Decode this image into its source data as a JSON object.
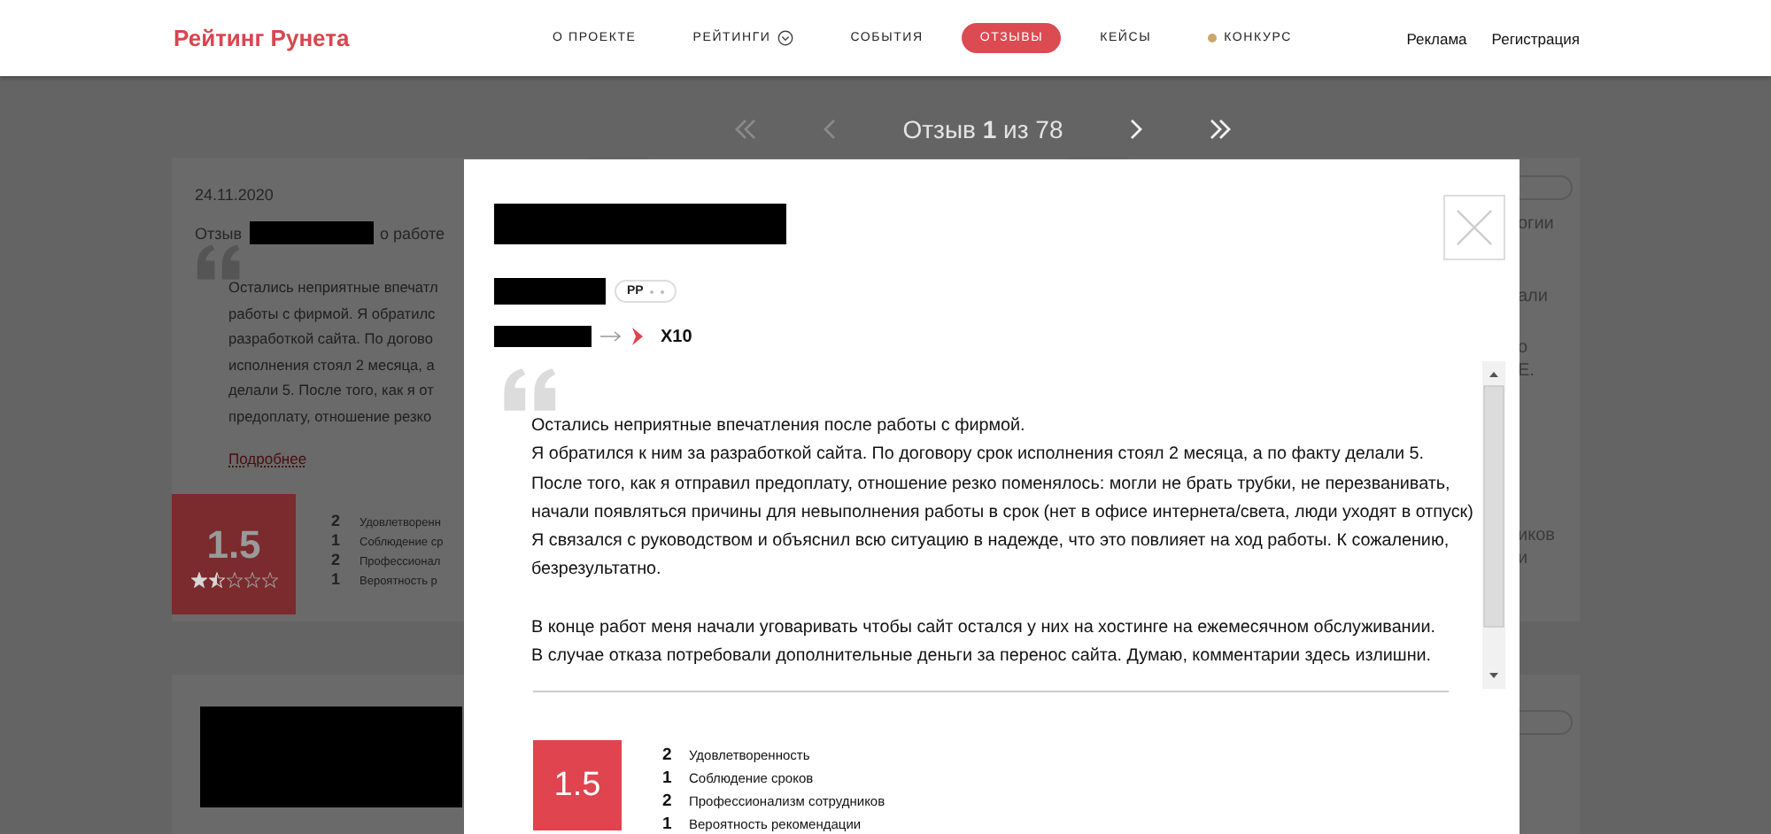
{
  "header": {
    "logo": "Рейтинг Рунета",
    "nav": [
      {
        "label": "О ПРОЕКТЕ",
        "selected": false,
        "kind": "plain"
      },
      {
        "label": "РЕЙТИНГИ",
        "selected": false,
        "kind": "dropdown"
      },
      {
        "label": "СОБЫТИЯ",
        "selected": false,
        "kind": "plain"
      },
      {
        "label": "ОТЗЫВЫ",
        "selected": true,
        "kind": "plain"
      },
      {
        "label": "КЕЙСЫ",
        "selected": false,
        "kind": "plain"
      },
      {
        "label": "КОНКУРС",
        "selected": false,
        "kind": "dot"
      }
    ],
    "links": [
      "Реклама",
      "Регистрация"
    ]
  },
  "pager": {
    "buttons": [
      {
        "kind": "first",
        "disabled": true
      },
      {
        "kind": "prev",
        "disabled": true
      },
      {
        "kind": "next",
        "disabled": false
      },
      {
        "kind": "last",
        "disabled": false
      }
    ],
    "label": "Отзыв **1** из 78"
  },
  "left_card": {
    "date": "24.11.2020",
    "title_before": "Отзыв",
    "title_after": "о работе",
    "lines": [
      "Остались неприятные впечатл",
      "работы с фирмой. Я обратилс",
      "разработкой сайта. По догово",
      "исполнения стоял 2 месяца, а",
      "делали 5. После того, как я от",
      "предоплату, отношение резко"
    ],
    "more": "Подробнее",
    "score": "1.5",
    "stars": 1.5,
    "criteria": [
      {
        "value": "2",
        "label": "Удовлетворенн"
      },
      {
        "value": "1",
        "label": "Соблюдение ср"
      },
      {
        "value": "2",
        "label": "Профессионал"
      },
      {
        "value": "1",
        "label": "Вероятность р"
      }
    ]
  },
  "right_card": {
    "fragments": [
      "огии",
      "али",
      "о",
      "Е.",
      "иков",
      "и"
    ]
  },
  "modal": {
    "tag": "PP",
    "target": "X10",
    "paragraphs": [
      "Остались неприятные впечатления после работы с фирмой.\nЯ обратился к ним за разработкой сайта. По договору срок исполнения стоял 2 месяца, а по факту делали 5.\nПосле того, как я отправил предоплату, отношение резко поменялось: могли не брать трубки, не перезванивать,\nначали появляться причины для невыполнения работы в срок (нет в офисе интернета/света, люди уходят в отпуск)\nЯ связался с руководством и объяснил всю ситуацию в надежде, что это повлияет на ход работы. К сожалению,\nбезрезультатно.",
      "В конце работ меня начали уговаривать чтобы сайт остался у них на хостинге на ежемесячном обслуживании.\nВ случае отказа потребовали дополнительные деньги за перенос сайта. Думаю, комментарии здесь излишни."
    ],
    "score": "1.5",
    "criteria": [
      {
        "value": "2",
        "label": "Удовлетворенность"
      },
      {
        "value": "1",
        "label": "Соблюдение сроков"
      },
      {
        "value": "2",
        "label": "Профессионализм сотрудников"
      },
      {
        "value": "1",
        "label": "Вероятность рекомендации"
      }
    ]
  }
}
